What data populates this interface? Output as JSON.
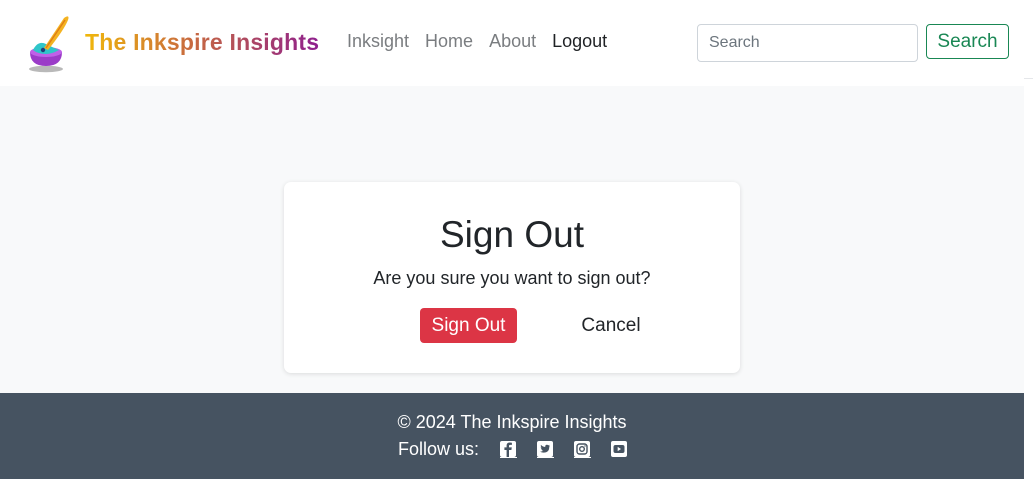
{
  "header": {
    "brand": "The Inkspire Insights",
    "nav": [
      {
        "label": "Inksight",
        "active": false
      },
      {
        "label": "Home",
        "active": false
      },
      {
        "label": "About",
        "active": false
      },
      {
        "label": "Logout",
        "active": true
      }
    ],
    "search": {
      "placeholder": "Search",
      "value": "",
      "button_label": "Search"
    }
  },
  "signout_card": {
    "title": "Sign Out",
    "message": "Are you sure you want to sign out?",
    "confirm_label": "Sign Out",
    "cancel_label": "Cancel"
  },
  "footer": {
    "copyright": "© 2024 The Inkspire Insights",
    "follow_label": "Follow us:",
    "social_icons": [
      "facebook-icon",
      "twitter-icon",
      "instagram-icon",
      "youtube-icon"
    ]
  },
  "colors": {
    "danger": "#dc3545",
    "success": "#198754",
    "footer_bg": "#465361",
    "page_bg": "#f8f9fa",
    "brand_gradient": [
      "#f0b70b",
      "#c86a3f",
      "#8e1f8e"
    ]
  }
}
